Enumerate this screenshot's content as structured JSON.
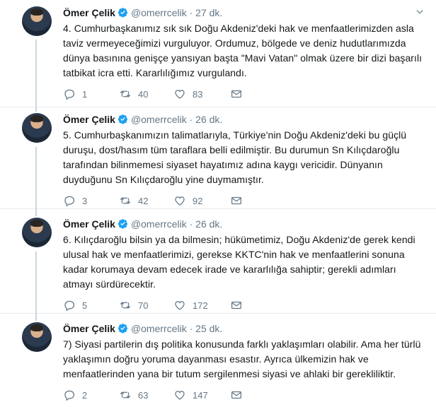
{
  "tweets": [
    {
      "name": "Ömer Çelik",
      "handle": "@omerrcelik",
      "time": "27 dk.",
      "text": "4. Cumhurbaşkanımız sık sık Doğu Akdeniz'deki hak ve menfaatlerimizden asla\ntaviz vermeyeceğimizi vurguluyor. Ordumuz, bölgede ve deniz hudutlarımızda\ndünya basınına genişçe yansıyan başta \"Mavi Vatan\" olmak üzere bir dizi başarılı\ntatbikat icra etti. Kararlılığımız vurgulandı.",
      "replies": "1",
      "retweets": "40",
      "likes": "83"
    },
    {
      "name": "Ömer Çelik",
      "handle": "@omerrcelik",
      "time": "26 dk.",
      "text": "5. Cumhurbaşkanımızın talimatlarıyla, Türkiye'nin Doğu Akdeniz'deki  bu güçlü\nduruşu, dost/hasım tüm taraflara belli edilmiştir. Bu durumun Sn Kılıçdaroğlu\ntarafından bilinmemesi siyaset hayatımız adına kaygı vericidir.  Dünyanın\nduyduğunu Sn Kılıçdaroğlu yine duymamıştır.",
      "replies": "3",
      "retweets": "42",
      "likes": "92"
    },
    {
      "name": "Ömer Çelik",
      "handle": "@omerrcelik",
      "time": "26 dk.",
      "text": "6. Kılıçdaroğlu bilsin ya da bilmesin; hükümetimiz, Doğu Akdeniz'de gerek kendi\nulusal hak ve menfaatlerimizi, gerekse KKTC'nin hak ve menfaatlerini sonuna\nkadar korumaya devam edecek irade ve kararlılığa sahiptir; gerekli adımları\natmayı sürdürecektir.",
      "replies": "5",
      "retweets": "70",
      "likes": "172"
    },
    {
      "name": "Ömer Çelik",
      "handle": "@omerrcelik",
      "time": "25 dk.",
      "text": "7) Siyasi partilerin dış politika konusunda farklı yaklaşımları olabilir. Ama her türlü\nyaklaşımın doğru yoruma dayanması esastır. Ayrıca ülkemizin hak ve\nmenfaatlerinden yana bir tutum sergilenmesi siyasi ve ahlaki bir gerekliliktir.",
      "replies": "2",
      "retweets": "63",
      "likes": "147"
    }
  ],
  "separator": "·",
  "icons": {
    "verified": "verified-badge-icon",
    "menu": "chevron-down-icon",
    "reply": "reply-icon",
    "retweet": "retweet-icon",
    "like": "heart-icon",
    "dm": "envelope-icon"
  },
  "colors": {
    "verified": "#1da1f2",
    "muted": "#657786",
    "thread_line": "#ccd6dd"
  }
}
